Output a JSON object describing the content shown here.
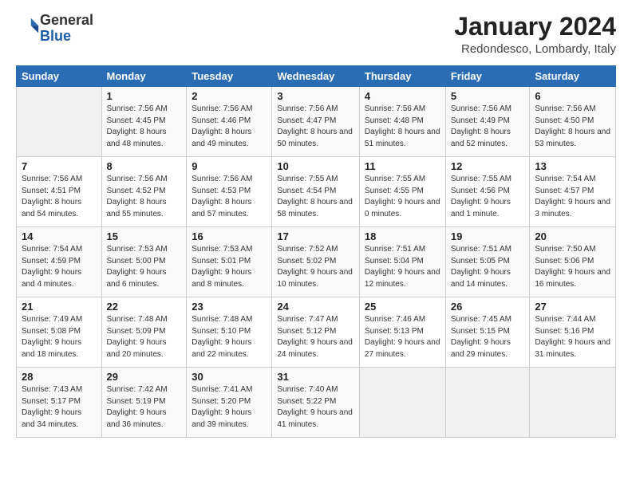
{
  "logo": {
    "general": "General",
    "blue": "Blue"
  },
  "header": {
    "month": "January 2024",
    "location": "Redondesco, Lombardy, Italy"
  },
  "weekdays": [
    "Sunday",
    "Monday",
    "Tuesday",
    "Wednesday",
    "Thursday",
    "Friday",
    "Saturday"
  ],
  "weeks": [
    [
      {
        "day": "",
        "sunrise": "",
        "sunset": "",
        "daylight": ""
      },
      {
        "day": "1",
        "sunrise": "Sunrise: 7:56 AM",
        "sunset": "Sunset: 4:45 PM",
        "daylight": "Daylight: 8 hours and 48 minutes."
      },
      {
        "day": "2",
        "sunrise": "Sunrise: 7:56 AM",
        "sunset": "Sunset: 4:46 PM",
        "daylight": "Daylight: 8 hours and 49 minutes."
      },
      {
        "day": "3",
        "sunrise": "Sunrise: 7:56 AM",
        "sunset": "Sunset: 4:47 PM",
        "daylight": "Daylight: 8 hours and 50 minutes."
      },
      {
        "day": "4",
        "sunrise": "Sunrise: 7:56 AM",
        "sunset": "Sunset: 4:48 PM",
        "daylight": "Daylight: 8 hours and 51 minutes."
      },
      {
        "day": "5",
        "sunrise": "Sunrise: 7:56 AM",
        "sunset": "Sunset: 4:49 PM",
        "daylight": "Daylight: 8 hours and 52 minutes."
      },
      {
        "day": "6",
        "sunrise": "Sunrise: 7:56 AM",
        "sunset": "Sunset: 4:50 PM",
        "daylight": "Daylight: 8 hours and 53 minutes."
      }
    ],
    [
      {
        "day": "7",
        "sunrise": "Sunrise: 7:56 AM",
        "sunset": "Sunset: 4:51 PM",
        "daylight": "Daylight: 8 hours and 54 minutes."
      },
      {
        "day": "8",
        "sunrise": "Sunrise: 7:56 AM",
        "sunset": "Sunset: 4:52 PM",
        "daylight": "Daylight: 8 hours and 55 minutes."
      },
      {
        "day": "9",
        "sunrise": "Sunrise: 7:56 AM",
        "sunset": "Sunset: 4:53 PM",
        "daylight": "Daylight: 8 hours and 57 minutes."
      },
      {
        "day": "10",
        "sunrise": "Sunrise: 7:55 AM",
        "sunset": "Sunset: 4:54 PM",
        "daylight": "Daylight: 8 hours and 58 minutes."
      },
      {
        "day": "11",
        "sunrise": "Sunrise: 7:55 AM",
        "sunset": "Sunset: 4:55 PM",
        "daylight": "Daylight: 9 hours and 0 minutes."
      },
      {
        "day": "12",
        "sunrise": "Sunrise: 7:55 AM",
        "sunset": "Sunset: 4:56 PM",
        "daylight": "Daylight: 9 hours and 1 minute."
      },
      {
        "day": "13",
        "sunrise": "Sunrise: 7:54 AM",
        "sunset": "Sunset: 4:57 PM",
        "daylight": "Daylight: 9 hours and 3 minutes."
      }
    ],
    [
      {
        "day": "14",
        "sunrise": "Sunrise: 7:54 AM",
        "sunset": "Sunset: 4:59 PM",
        "daylight": "Daylight: 9 hours and 4 minutes."
      },
      {
        "day": "15",
        "sunrise": "Sunrise: 7:53 AM",
        "sunset": "Sunset: 5:00 PM",
        "daylight": "Daylight: 9 hours and 6 minutes."
      },
      {
        "day": "16",
        "sunrise": "Sunrise: 7:53 AM",
        "sunset": "Sunset: 5:01 PM",
        "daylight": "Daylight: 9 hours and 8 minutes."
      },
      {
        "day": "17",
        "sunrise": "Sunrise: 7:52 AM",
        "sunset": "Sunset: 5:02 PM",
        "daylight": "Daylight: 9 hours and 10 minutes."
      },
      {
        "day": "18",
        "sunrise": "Sunrise: 7:51 AM",
        "sunset": "Sunset: 5:04 PM",
        "daylight": "Daylight: 9 hours and 12 minutes."
      },
      {
        "day": "19",
        "sunrise": "Sunrise: 7:51 AM",
        "sunset": "Sunset: 5:05 PM",
        "daylight": "Daylight: 9 hours and 14 minutes."
      },
      {
        "day": "20",
        "sunrise": "Sunrise: 7:50 AM",
        "sunset": "Sunset: 5:06 PM",
        "daylight": "Daylight: 9 hours and 16 minutes."
      }
    ],
    [
      {
        "day": "21",
        "sunrise": "Sunrise: 7:49 AM",
        "sunset": "Sunset: 5:08 PM",
        "daylight": "Daylight: 9 hours and 18 minutes."
      },
      {
        "day": "22",
        "sunrise": "Sunrise: 7:48 AM",
        "sunset": "Sunset: 5:09 PM",
        "daylight": "Daylight: 9 hours and 20 minutes."
      },
      {
        "day": "23",
        "sunrise": "Sunrise: 7:48 AM",
        "sunset": "Sunset: 5:10 PM",
        "daylight": "Daylight: 9 hours and 22 minutes."
      },
      {
        "day": "24",
        "sunrise": "Sunrise: 7:47 AM",
        "sunset": "Sunset: 5:12 PM",
        "daylight": "Daylight: 9 hours and 24 minutes."
      },
      {
        "day": "25",
        "sunrise": "Sunrise: 7:46 AM",
        "sunset": "Sunset: 5:13 PM",
        "daylight": "Daylight: 9 hours and 27 minutes."
      },
      {
        "day": "26",
        "sunrise": "Sunrise: 7:45 AM",
        "sunset": "Sunset: 5:15 PM",
        "daylight": "Daylight: 9 hours and 29 minutes."
      },
      {
        "day": "27",
        "sunrise": "Sunrise: 7:44 AM",
        "sunset": "Sunset: 5:16 PM",
        "daylight": "Daylight: 9 hours and 31 minutes."
      }
    ],
    [
      {
        "day": "28",
        "sunrise": "Sunrise: 7:43 AM",
        "sunset": "Sunset: 5:17 PM",
        "daylight": "Daylight: 9 hours and 34 minutes."
      },
      {
        "day": "29",
        "sunrise": "Sunrise: 7:42 AM",
        "sunset": "Sunset: 5:19 PM",
        "daylight": "Daylight: 9 hours and 36 minutes."
      },
      {
        "day": "30",
        "sunrise": "Sunrise: 7:41 AM",
        "sunset": "Sunset: 5:20 PM",
        "daylight": "Daylight: 9 hours and 39 minutes."
      },
      {
        "day": "31",
        "sunrise": "Sunrise: 7:40 AM",
        "sunset": "Sunset: 5:22 PM",
        "daylight": "Daylight: 9 hours and 41 minutes."
      },
      {
        "day": "",
        "sunrise": "",
        "sunset": "",
        "daylight": ""
      },
      {
        "day": "",
        "sunrise": "",
        "sunset": "",
        "daylight": ""
      },
      {
        "day": "",
        "sunrise": "",
        "sunset": "",
        "daylight": ""
      }
    ]
  ]
}
